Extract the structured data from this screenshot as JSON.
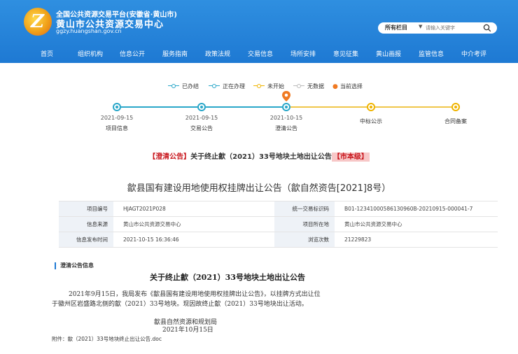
{
  "header": {
    "brand_line1": "全国公共资源交易平台(安徽省·黄山市)",
    "brand_line2": "黄山市公共资源交易中心",
    "domain": "ggzy.huangshan.gov.cn",
    "colors": {
      "primary": "#1e79d3",
      "accent": "#c8161d"
    }
  },
  "search": {
    "column_label": "所有栏目",
    "placeholder": "请输入关键字",
    "icon": "search-icon"
  },
  "nav": [
    "首页",
    "组织机构",
    "信息公开",
    "服务指南",
    "政策法规",
    "交易信息",
    "场所安排",
    "意见征集",
    "黄山画报",
    "监管信息",
    "中介考评"
  ],
  "legend": {
    "done": "已办结",
    "in_progress": "正在办理",
    "not_started": "未开始",
    "no_data": "无数据",
    "current": "当前选择"
  },
  "timeline": [
    {
      "date": "2021-09-15",
      "name": "项目信息",
      "state": "done"
    },
    {
      "date": "2021-09-15",
      "name": "交易公告",
      "state": "done"
    },
    {
      "date": "2021-10-15",
      "name": "澄清公告",
      "state": "current"
    },
    {
      "date": "",
      "name": "中标公示",
      "state": "not_started"
    },
    {
      "date": "",
      "name": "合同备案",
      "state": "not_started"
    }
  ],
  "announcement": {
    "prefix": "【澄清公告】",
    "title": "关于终止歙（2021）33号地块土地出让公告",
    "tag": "【市本级】"
  },
  "main_title": "歙县国有建设用地使用权挂牌出让公告（歙自然资告[2021]8号）",
  "info": {
    "project_no_label": "项目编号",
    "project_no": "HJAGT2021P028",
    "unified_code_label": "统一交易标识码",
    "unified_code": "B01-12341000586130960B-20210915-000041-7",
    "source_label": "信息来源",
    "source": "黄山市公共资源交易中心",
    "location_label": "项目所在地",
    "location": "黄山市公共资源交易中心",
    "publish_label": "信息发布时间",
    "publish": "2021-10-15 16:36:46",
    "views_label": "浏览次数",
    "views": "21229823"
  },
  "clarification": {
    "section_label": "澄清公告信息",
    "doc_title": "关于终止歙（2021）33号地块土地出让公告",
    "para_line1": "2021年9月15日，我局发布《歙县国有建设用地使用权挂牌出让公告》，以挂牌方式出让位",
    "para_line2": "于徽州区岩盛路北侧的歙（2021）33号地块。现因故终止歙（2021）33号地块出让活动。",
    "signer": "歙县自然资源和规划局",
    "sign_date": "2021年10月15日",
    "attachment_label": "附件：",
    "attachment_file": "歙（2021）33号地块终止出让公告.doc"
  }
}
